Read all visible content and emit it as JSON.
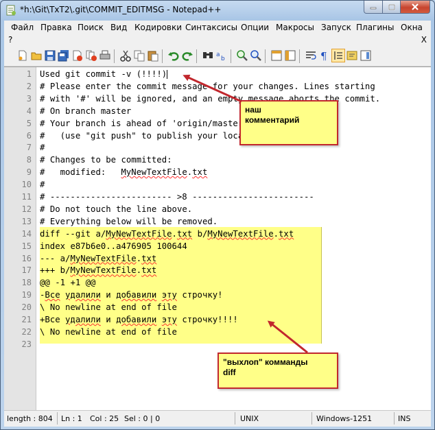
{
  "window": {
    "title": "*h:\\Git\\TxT2\\.git\\COMMIT_EDITMSG - Notepad++",
    "icon": "notepad-plus-plus-icon"
  },
  "menu": {
    "items": [
      "Файл",
      "Правка",
      "Поиск",
      "Вид",
      "Кодировки",
      "Синтаксисы",
      "Опции",
      "Макросы",
      "Запуск",
      "Плагины",
      "Окна"
    ],
    "help": "?",
    "close_doc": "X"
  },
  "toolbar": {
    "icons": [
      "new-file-icon",
      "open-file-icon",
      "save-icon",
      "save-all-icon",
      "close-icon",
      "close-all-icon",
      "print-icon",
      "cut-icon",
      "copy-icon",
      "paste-icon",
      "undo-icon",
      "redo-icon",
      "find-icon",
      "replace-icon",
      "zoom-in-icon",
      "zoom-out-icon",
      "sync-vertical-icon",
      "sync-horizontal-icon",
      "word-wrap-icon",
      "show-all-chars-icon",
      "indent-guide-icon",
      "udl-icon",
      "doc-map-icon"
    ]
  },
  "editor": {
    "lines": [
      "Used git commit -v (!!!!)",
      "# Please enter the commit message for your changes. Lines starting",
      "# with '#' will be ignored, and an empty message aborts the commit.",
      "# On branch master",
      "# Your branch is ahead of 'origin/master' by 1 commits.",
      "#   (use \"git push\" to publish your local commits)",
      "#",
      "# Changes to be committed:",
      "#   modified:   MyNewTextFile.txt",
      "#",
      "# ------------------------ >8 ------------------------",
      "# Do not touch the line above.",
      "# Everything below will be removed.",
      "diff --git a/MyNewTextFile.txt b/MyNewTextFile.txt",
      "index e87b6e0..a476905 100644",
      "--- a/MyNewTextFile.txt",
      "+++ b/MyNewTextFile.txt",
      "@@ -1 +1 @@",
      "-Все удалили и добавили эту строчку!",
      "\\ No newline at end of file",
      "+Все удалили и добавили эту строчку!!!!",
      "\\ No newline at end of file",
      ""
    ]
  },
  "annotations": {
    "comment": "наш\nкомментарий",
    "diff_output": "\"выхлоп\" комманды\ndiff"
  },
  "status": {
    "length": "length : 804",
    "ln": "Ln : 1",
    "col": "Col : 25",
    "sel": "Sel : 0 | 0",
    "eol": "UNIX",
    "encoding": "Windows-1251",
    "mode": "INS"
  },
  "colors": {
    "highlight": "#ffff88",
    "annotation_border": "#c1272d"
  }
}
